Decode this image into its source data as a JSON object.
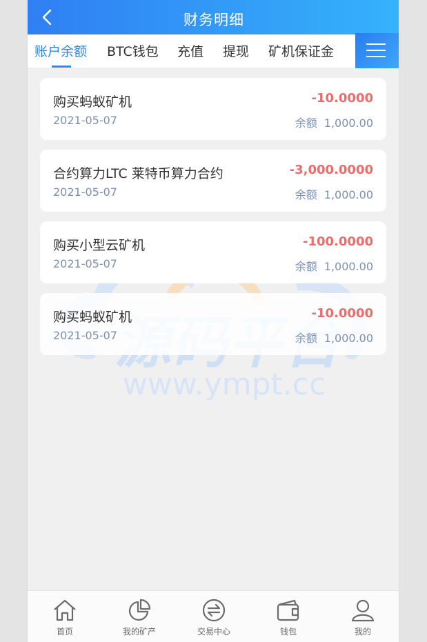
{
  "header": {
    "title": "财务明细"
  },
  "tabs": [
    {
      "label": "账户余额",
      "active": true
    },
    {
      "label": "BTC钱包"
    },
    {
      "label": "充值"
    },
    {
      "label": "提现"
    },
    {
      "label": "矿机保证金"
    }
  ],
  "records": [
    {
      "name": "购买蚂蚁矿机",
      "date": "2021-05-07",
      "amount": "-10.0000",
      "balance_label": "余额",
      "balance": "1,000.00"
    },
    {
      "name": "合约算力LTC 莱特币算力合约",
      "date": "2021-05-07",
      "amount": "-3,000.0000",
      "balance_label": "余额",
      "balance": "1,000.00"
    },
    {
      "name": "购买小型云矿机",
      "date": "2021-05-07",
      "amount": "-100.0000",
      "balance_label": "余额",
      "balance": "1,000.00"
    },
    {
      "name": "购买蚂蚁矿机",
      "date": "2021-05-07",
      "amount": "-10.0000",
      "balance_label": "余额",
      "balance": "1,000.00"
    }
  ],
  "watermark": {
    "brand": "源码平台",
    "url": "www.ympt.cc"
  },
  "tabbar": [
    {
      "label": "首页",
      "icon": "home-icon"
    },
    {
      "label": "我的矿产",
      "icon": "pie-chart-icon"
    },
    {
      "label": "交易中心",
      "icon": "exchange-icon"
    },
    {
      "label": "钱包",
      "icon": "wallet-icon"
    },
    {
      "label": "我的",
      "icon": "user-icon"
    }
  ],
  "colors": {
    "accent": "#2f87ec",
    "negative": "#ee6b6b",
    "muted": "#7a8fb5"
  }
}
